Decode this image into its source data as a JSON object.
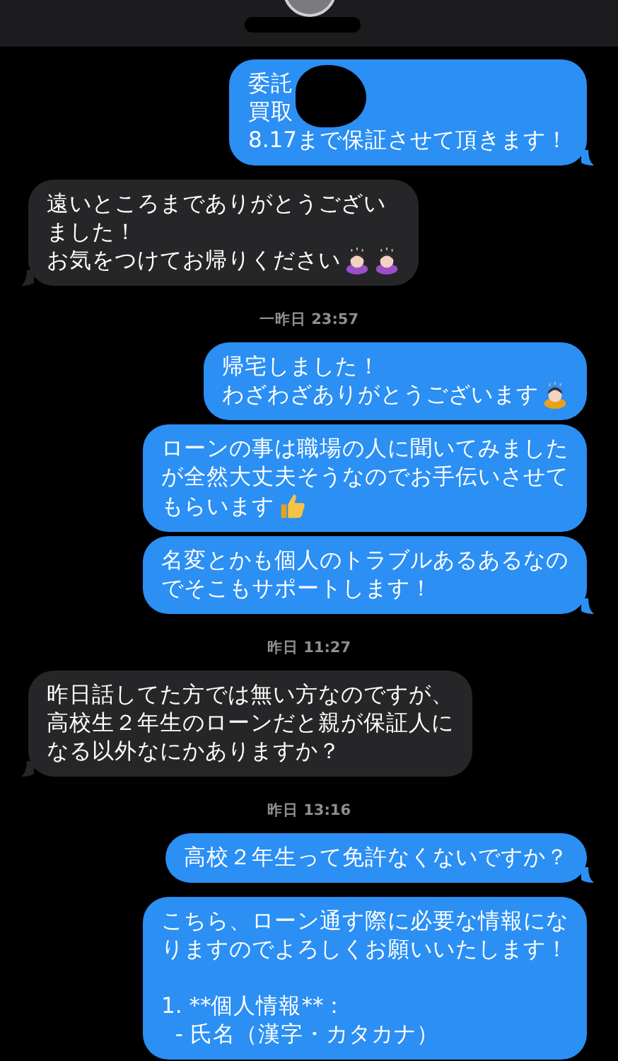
{
  "header": {
    "avatar": true,
    "name_redacted": true
  },
  "messages": [
    {
      "kind": "message",
      "sent": true,
      "tail": true,
      "redacted": true,
      "paragraphs": [
        [
          "委託",
          "買取",
          "8.17まで保証させて頂きます！"
        ]
      ]
    },
    {
      "kind": "message",
      "sent": false,
      "tail": true,
      "paragraphs": [
        [
          "遠いところまでありがとうござい",
          "ました！",
          "お気をつけてお帰りください"
        ]
      ],
      "emoji": [
        {
          "kind": "bow",
          "color": "#9b4fc9"
        },
        {
          "kind": "bow",
          "color": "#9b4fc9"
        }
      ]
    },
    {
      "kind": "timestamp",
      "text": "一昨日 23:57"
    },
    {
      "kind": "message",
      "sent": true,
      "tail": false,
      "paragraphs": [
        [
          "帰宅しました！",
          "わざわざありがとうございます"
        ]
      ],
      "emoji": [
        {
          "kind": "bow",
          "color": "#e8a21a"
        }
      ]
    },
    {
      "kind": "message",
      "sent": true,
      "tail": false,
      "paragraphs": [
        [
          "ローンの事は職場の人に聞いてみました",
          "が全然大丈夫そうなのでお手伝いさせて",
          "もらいます"
        ]
      ],
      "emoji": [
        {
          "kind": "thumb",
          "color": "#f6c343"
        }
      ]
    },
    {
      "kind": "message",
      "sent": true,
      "tail": true,
      "paragraphs": [
        [
          "名変とかも個人のトラブルあるあるなの",
          "でそこもサポートします！"
        ]
      ]
    },
    {
      "kind": "timestamp",
      "text": "昨日 11:27"
    },
    {
      "kind": "message",
      "sent": false,
      "tail": true,
      "paragraphs": [
        [
          "昨日話してた方では無い方なのですが、",
          "高校生２年生のローンだと親が保証人に",
          "なる以外なにかありますか？"
        ]
      ]
    },
    {
      "kind": "timestamp",
      "text": "昨日 13:16"
    },
    {
      "kind": "message",
      "sent": true,
      "tail": true,
      "paragraphs": [
        [
          "高校２年生って免許なくないですか？"
        ]
      ]
    },
    {
      "kind": "message",
      "sent": true,
      "tail": false,
      "paragraphs": [
        [
          "こちら、ローン通す際に必要な情報にな",
          "りますのでよろしくお願いいたします！"
        ],
        [
          "1. **個人情報**：",
          "  - 氏名（漢字・カタカナ）"
        ]
      ]
    }
  ]
}
